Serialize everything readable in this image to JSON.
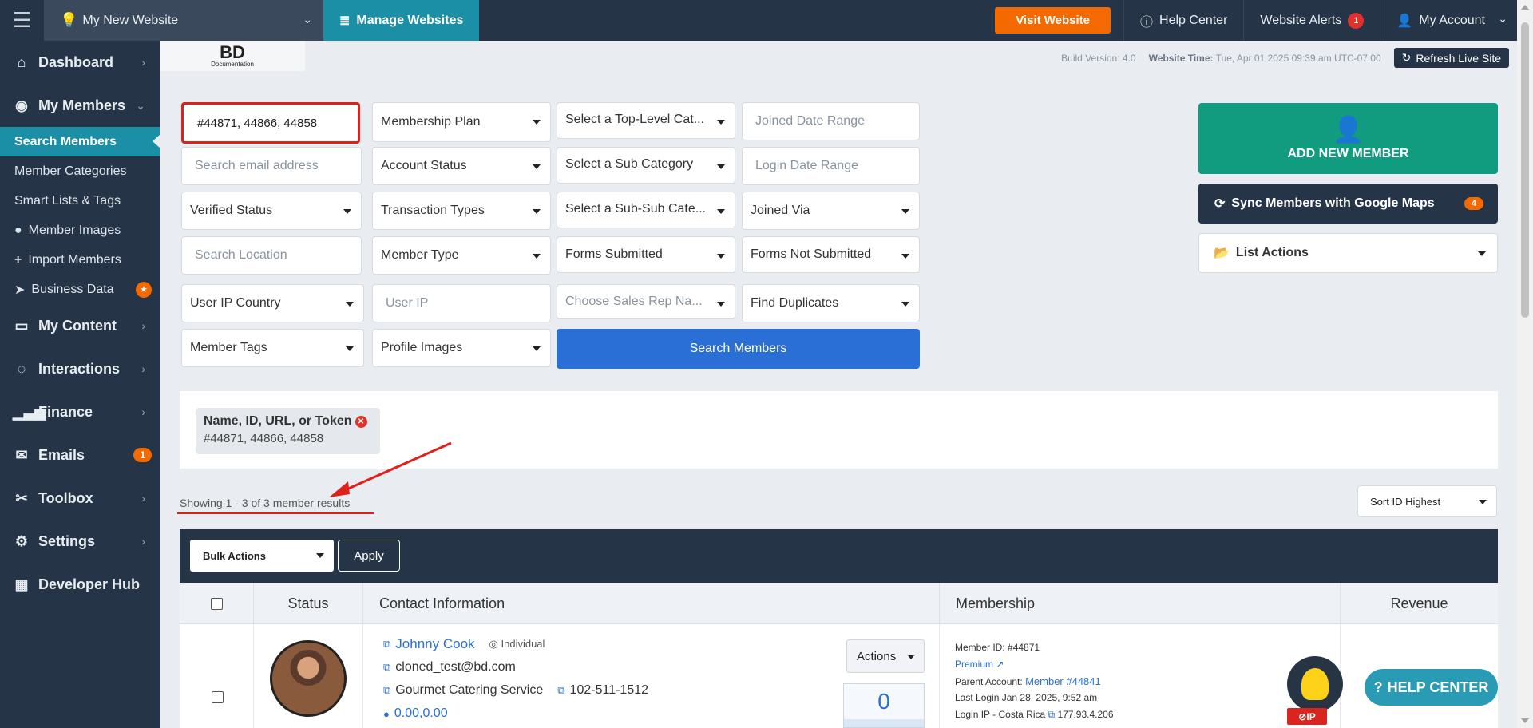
{
  "topbar": {
    "site_name": "My New Website",
    "manage_websites": "Manage Websites",
    "visit_website": "Visit Website",
    "help_center": "Help Center",
    "website_alerts": "Website Alerts",
    "alerts_count": "1",
    "my_account": "My Account"
  },
  "sidebar": {
    "dashboard": "Dashboard",
    "my_members": "My Members",
    "sub": {
      "search_members": "Search Members",
      "member_categories": "Member Categories",
      "smart_lists": "Smart Lists & Tags",
      "member_images": "Member Images",
      "import_members": "Import Members",
      "business_data": "Business Data"
    },
    "my_content": "My Content",
    "interactions": "Interactions",
    "finance": "Finance",
    "emails": "Emails",
    "emails_count": "1",
    "toolbox": "Toolbox",
    "settings": "Settings",
    "developer_hub": "Developer Hub"
  },
  "logo": {
    "line1": "BD",
    "line2": "Documentation"
  },
  "build": {
    "version_label": "Build Version:",
    "version": "4.0",
    "time_label": "Website Time:",
    "time": "Tue, Apr 01 2025 09:39 am UTC-07:00",
    "refresh": "Refresh Live Site"
  },
  "filters": {
    "name_value": "#44871, 44866, 44858",
    "membership_plan": "Membership Plan",
    "top_level_category": "Select a Top-Level Cat...",
    "joined_date_range": "Joined Date Range",
    "email_ph": "Search email address",
    "account_status": "Account Status",
    "sub_category": "Select a Sub Category",
    "login_date_range": "Login Date Range",
    "verified_status": "Verified Status",
    "transaction_types": "Transaction Types",
    "sub_sub_category": "Select a Sub-Sub Cate...",
    "joined_via": "Joined Via",
    "location_ph": "Search Location",
    "member_type": "Member Type",
    "forms_submitted": "Forms Submitted",
    "forms_not_submitted": "Forms Not Submitted",
    "user_ip_country": "User IP Country",
    "user_ip_ph": "User IP",
    "sales_rep": "Choose Sales Rep Na...",
    "find_duplicates": "Find Duplicates",
    "member_tags": "Member Tags",
    "profile_images": "Profile Images",
    "search_button": "Search Members"
  },
  "right_actions": {
    "add_new_member": "ADD NEW MEMBER",
    "sync_google_maps": "Sync Members with Google Maps",
    "sync_count": "4",
    "list_actions": "List Actions"
  },
  "active_filter": {
    "title": "Name, ID, URL, or Token",
    "value": "#44871, 44866, 44858"
  },
  "results": {
    "showing": "Showing 1 - 3 of 3 member results",
    "sort": "Sort ID Highest"
  },
  "table": {
    "bulk_actions": "Bulk Actions",
    "apply": "Apply",
    "columns": [
      "Status",
      "Contact Information",
      "Membership",
      "Revenue"
    ],
    "row": {
      "name": "Johnny Cook",
      "type": "Individual",
      "email": "cloned_test@bd.com",
      "company": "Gourmet Catering Service",
      "phone": "102-511-1512",
      "coords": "0.00,0.00",
      "actions": "Actions",
      "count": "0",
      "member_id_label": "Member ID:",
      "member_id": "#44871",
      "plan": "Premium",
      "parent_label": "Parent Account:",
      "parent": "Member #44841",
      "last_login_label": "Last Login",
      "last_login": "Jan 28, 2025, 9:52 am",
      "login_ip_label": "Login IP - Costa Rica",
      "login_ip": "177.93.4.206"
    }
  },
  "widgets": {
    "help_center": "HELP CENTER",
    "ip_badge": "IP"
  },
  "colors": {
    "navy": "#253447",
    "teal": "#1b8fa6",
    "orange": "#f56a00",
    "green": "#119b7f",
    "blue": "#2a6fd6",
    "red": "#e0201a"
  }
}
